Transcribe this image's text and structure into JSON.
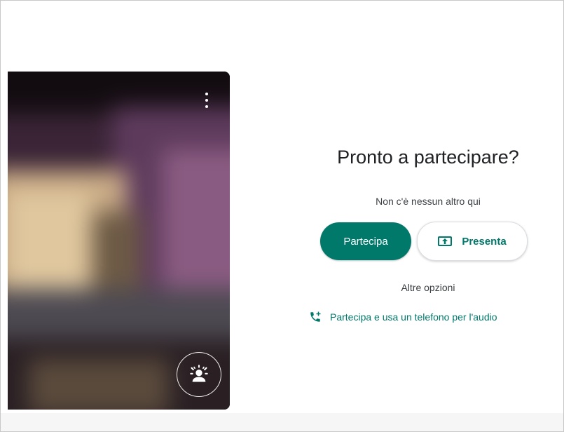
{
  "join": {
    "title": "Pronto a partecipare?",
    "status": "Non c'è nessun altro qui",
    "join_label": "Partecipa",
    "present_label": "Presenta",
    "other_options_label": "Altre opzioni",
    "phone_link_label": "Partecipa e usa un telefono per l'audio"
  },
  "icons": {
    "more": "more-vert-icon",
    "effects": "visual-effects-icon",
    "present": "present-screen-icon",
    "phone": "add-call-icon"
  },
  "colors": {
    "accent": "#00796b",
    "text": "#202124"
  }
}
